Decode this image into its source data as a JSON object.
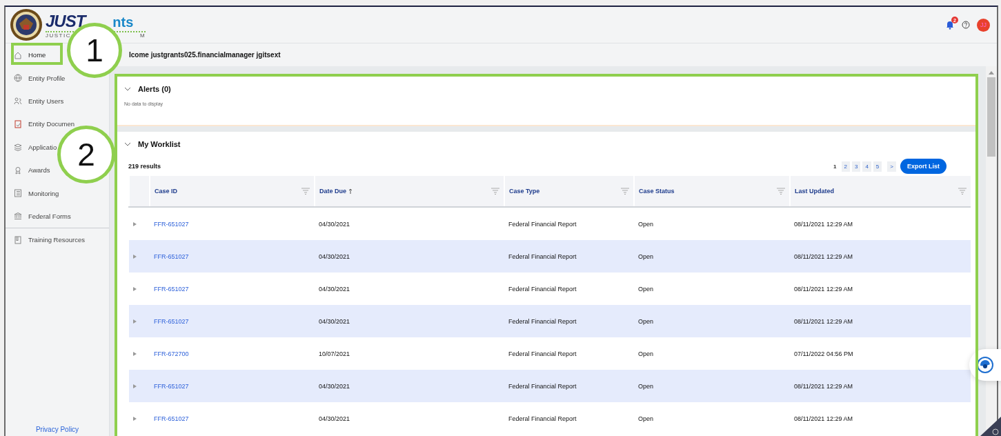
{
  "header": {
    "logo_word": "JUST",
    "logo_tail": "nts",
    "logo_sub": "JUSTIC",
    "logo_sub_tail": "M",
    "notification_count": "2",
    "avatar": "JJ"
  },
  "sidebar": {
    "items": [
      {
        "label": "Home",
        "selected": true
      },
      {
        "label": "Entity Profile",
        "selected": false
      },
      {
        "label": "Entity Users",
        "selected": false
      },
      {
        "label": "Entity Documen",
        "selected": false
      },
      {
        "label": "Applicatio",
        "selected": false
      },
      {
        "label": "Awards",
        "selected": false
      },
      {
        "label": "Monitoring",
        "selected": false
      },
      {
        "label": "Federal Forms",
        "selected": false
      }
    ],
    "secondary_items": [
      {
        "label": "Training Resources",
        "selected": false
      }
    ],
    "footer_link": "Privacy Policy"
  },
  "welcome": "lcome justgrants025.financialmanager jgitsext",
  "alerts": {
    "title": "Alerts (0)",
    "expanded": true,
    "empty_text": "No data to display"
  },
  "worklist": {
    "title": "My Worklist",
    "expanded": true,
    "results": "219 results",
    "pages": [
      {
        "label": "1",
        "selected": true
      },
      {
        "label": "2",
        "selected": false
      },
      {
        "label": "3",
        "selected": false
      },
      {
        "label": "4",
        "selected": false
      },
      {
        "label": "5",
        "selected": false
      }
    ],
    "next": ">",
    "export": "Export List",
    "columns": [
      {
        "label": "Case ID",
        "sorted": false
      },
      {
        "label": "Date Due",
        "sorted": true
      },
      {
        "label": "Case Type",
        "sorted": false
      },
      {
        "label": "Case Status",
        "sorted": false
      },
      {
        "label": "Last Updated",
        "sorted": false
      }
    ],
    "rows": [
      [
        "FFR-651027",
        "04/30/2021",
        "Federal Financial Report",
        "Open",
        "08/11/2021 12:29 AM"
      ],
      [
        "FFR-651027",
        "04/30/2021",
        "Federal Financial Report",
        "Open",
        "08/11/2021 12:29 AM"
      ],
      [
        "FFR-651027",
        "04/30/2021",
        "Federal Financial Report",
        "Open",
        "08/11/2021 12:29 AM"
      ],
      [
        "FFR-651027",
        "04/30/2021",
        "Federal Financial Report",
        "Open",
        "08/11/2021 12:29 AM"
      ],
      [
        "FFR-672700",
        "10/07/2021",
        "Federal Financial Report",
        "Open",
        "07/11/2022 04:56 PM"
      ],
      [
        "FFR-651027",
        "04/30/2021",
        "Federal Financial Report",
        "Open",
        "08/11/2021 12:29 AM"
      ],
      [
        "FFR-651027",
        "04/30/2021",
        "Federal Financial Report",
        "Open",
        "08/11/2021 12:29 AM"
      ]
    ]
  },
  "callouts": [
    {
      "label": "1"
    },
    {
      "label": "2"
    }
  ]
}
